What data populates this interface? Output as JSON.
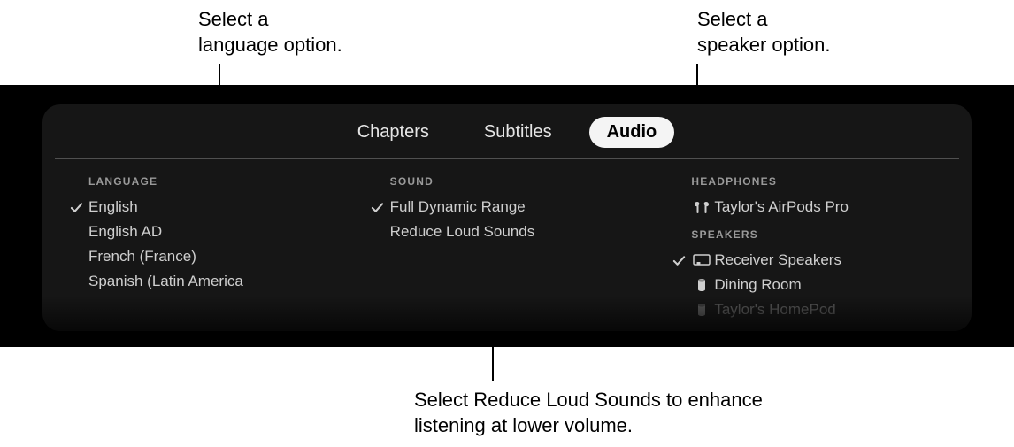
{
  "annotations": {
    "top_left": "Select a\nlanguage option.",
    "top_right": "Select a\nspeaker option.",
    "bottom": "Select Reduce Loud Sounds to enhance\nlistening at lower volume."
  },
  "tabs": {
    "chapters": "Chapters",
    "subtitles": "Subtitles",
    "audio": "Audio"
  },
  "language": {
    "heading": "LANGUAGE",
    "items": [
      {
        "label": "English",
        "selected": true
      },
      {
        "label": "English AD",
        "selected": false
      },
      {
        "label": "French (France)",
        "selected": false
      },
      {
        "label": "Spanish (Latin America",
        "selected": false
      }
    ]
  },
  "sound": {
    "heading": "SOUND",
    "items": [
      {
        "label": "Full Dynamic Range",
        "selected": true
      },
      {
        "label": "Reduce Loud Sounds",
        "selected": false
      }
    ]
  },
  "headphones": {
    "heading": "HEADPHONES",
    "items": [
      {
        "label": "Taylor's AirPods Pro",
        "icon": "airpods",
        "selected": false
      }
    ]
  },
  "speakers": {
    "heading": "SPEAKERS",
    "items": [
      {
        "label": "Receiver Speakers",
        "icon": "tv",
        "selected": true
      },
      {
        "label": "Dining Room",
        "icon": "homepod",
        "selected": false
      },
      {
        "label": "Taylor's HomePod",
        "icon": "homepod",
        "selected": false,
        "faded": true
      }
    ]
  }
}
